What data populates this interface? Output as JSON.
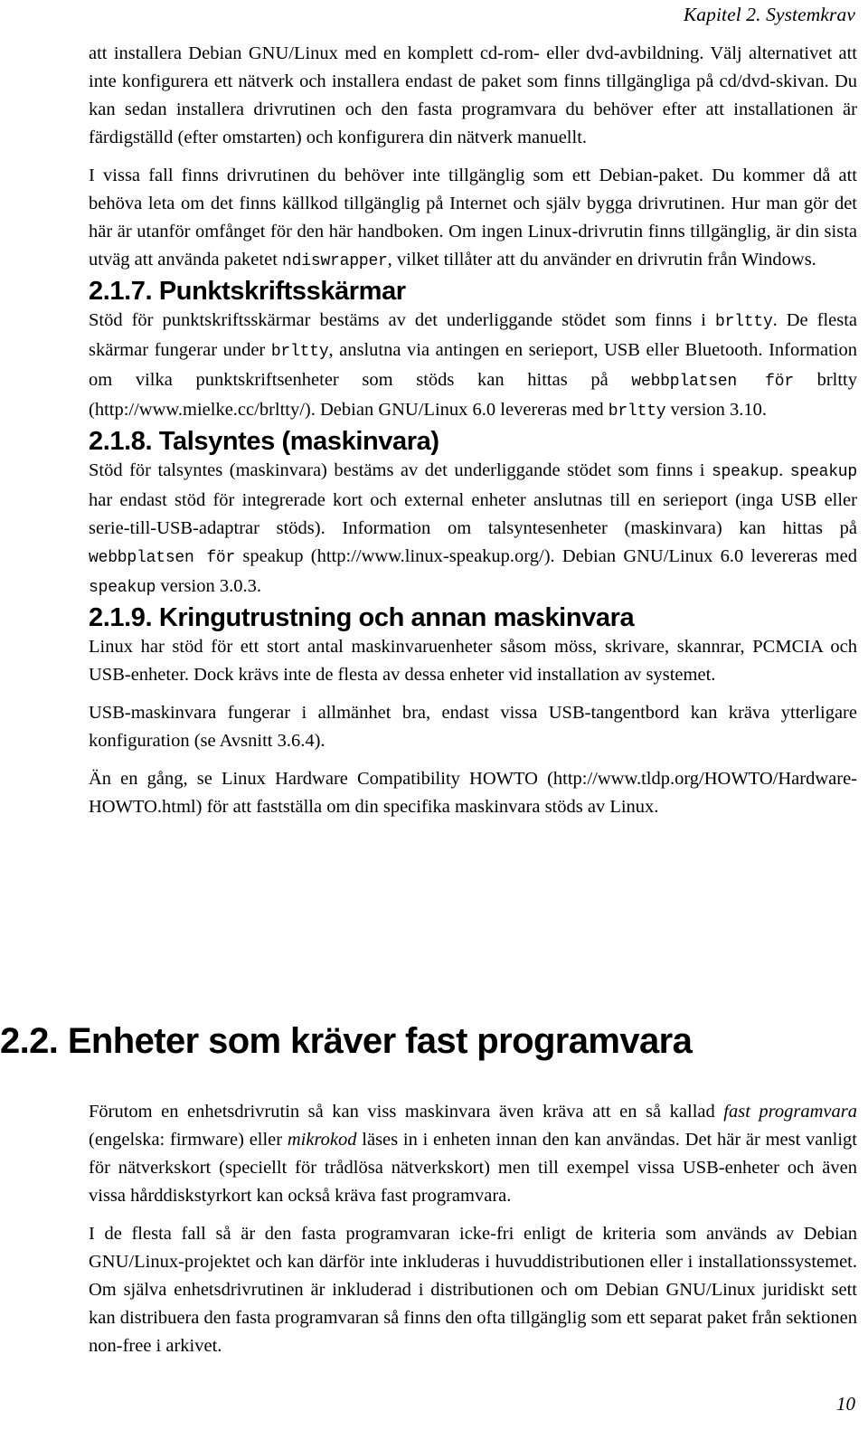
{
  "page": {
    "running_header": "Kapitel 2. Systemkrav",
    "folio": "10"
  },
  "intro": {
    "para1_a": "att installera Debian GNU/Linux med en komplett cd-rom- eller dvd-avbildning. Välj alternativet att inte konfigurera ett nätverk och installera endast de paket som finns tillgängliga på cd/dvd-skivan. Du kan sedan installera drivrutinen och den fasta programvara du behöver efter att installationen är färdigställd (efter omstarten) och konfigurera din nätverk manuellt.",
    "para2_a": "I vissa fall finns drivrutinen du behöver inte tillgänglig som ett Debian-paket. Du kommer då att behöva leta om det finns källkod tillgänglig på Internet och själv bygga drivrutinen. Hur man gör det här är utanför omfånget för den här handboken. Om ingen Linux-drivrutin finns tillgänglig, är din sista utväg att använda paketet ",
    "para2_code": "ndiswrapper",
    "para2_b": ", vilket tillåter att du använder en drivrutin från Windows."
  },
  "section_217": {
    "heading": "2.1.7. Punktskriftsskärmar",
    "p_a": "Stöd för punktskriftsskärmar bestäms av det underliggande stödet som finns i ",
    "p_code1": "brltty",
    "p_b": ". De flesta skärmar fungerar under ",
    "p_code2": "brltty",
    "p_c": ", anslutna via antingen en serieport, USB eller Bluetooth. Information om vilka punktskriftsenheter som stöds kan hittas på ",
    "p_code3": "webbplatsen för",
    "p_d": " brltty (http://www.mielke.cc/brltty/). Debian GNU/Linux 6.0 levereras med ",
    "p_code4": "brltty",
    "p_e": " version 3.10."
  },
  "section_218": {
    "heading": "2.1.8. Talsyntes (maskinvara)",
    "p_a": "Stöd för talsyntes (maskinvara) bestäms av det underliggande stödet som finns i ",
    "p_code1": "speakup",
    "p_b": ". ",
    "p_code2": "speakup",
    "p_c": " har endast stöd för integrerade kort och external enheter anslutnas till en serieport (inga USB eller serie-till-USB-adaptrar stöds). Information om talsyntesenheter (maskinvara) kan hittas på ",
    "p_code3": "webbplatsen för",
    "p_d": " speakup (http://www.linux-speakup.org/). Debian GNU/Linux 6.0 levereras med ",
    "p_code4": "speakup",
    "p_e": " version 3.0.3."
  },
  "section_219": {
    "heading": "2.1.9. Kringutrustning och annan maskinvara",
    "para1": "Linux har stöd för ett stort antal maskinvaruenheter såsom möss, skrivare, skannrar, PCMCIA och USB-enheter. Dock krävs inte de flesta av dessa enheter vid installation av systemet.",
    "para2": "USB-maskinvara fungerar i allmänhet bra, endast vissa USB-tangentbord kan kräva ytterligare konfiguration (se Avsnitt 3.6.4).",
    "para3": "Än en gång, se Linux Hardware Compatibility HOWTO (http://www.tldp.org/HOWTO/Hardware-HOWTO.html) för att fastställa om din specifika maskinvara stöds av Linux."
  },
  "section_22": {
    "heading": "2.2. Enheter som kräver fast programvara",
    "para1_a": "Förutom en enhetsdrivrutin så kan viss maskinvara även kräva att en så kallad ",
    "para1_em1": "fast programvara",
    "para1_b": " (engelska: firmware) eller ",
    "para1_em2": "mikrokod",
    "para1_c": " läses in i enheten innan den kan användas. Det här är mest vanligt för nätverkskort (speciellt för trådlösa nätverkskort) men till exempel vissa USB-enheter och även vissa hårddiskstyrkort kan också kräva fast programvara.",
    "para2": "I de flesta fall så är den fasta programvaran icke-fri enligt de kriteria som används av Debian GNU/Linux-projektet och kan därför inte inkluderas i huvuddistributionen eller i installationssystemet. Om själva enhetsdrivrutinen är inkluderad i distributionen och om Debian GNU/Linux juridiskt sett kan distribuera den fasta programvaran så finns den ofta tillgänglig som ett separat paket från sektionen non-free i arkivet."
  }
}
